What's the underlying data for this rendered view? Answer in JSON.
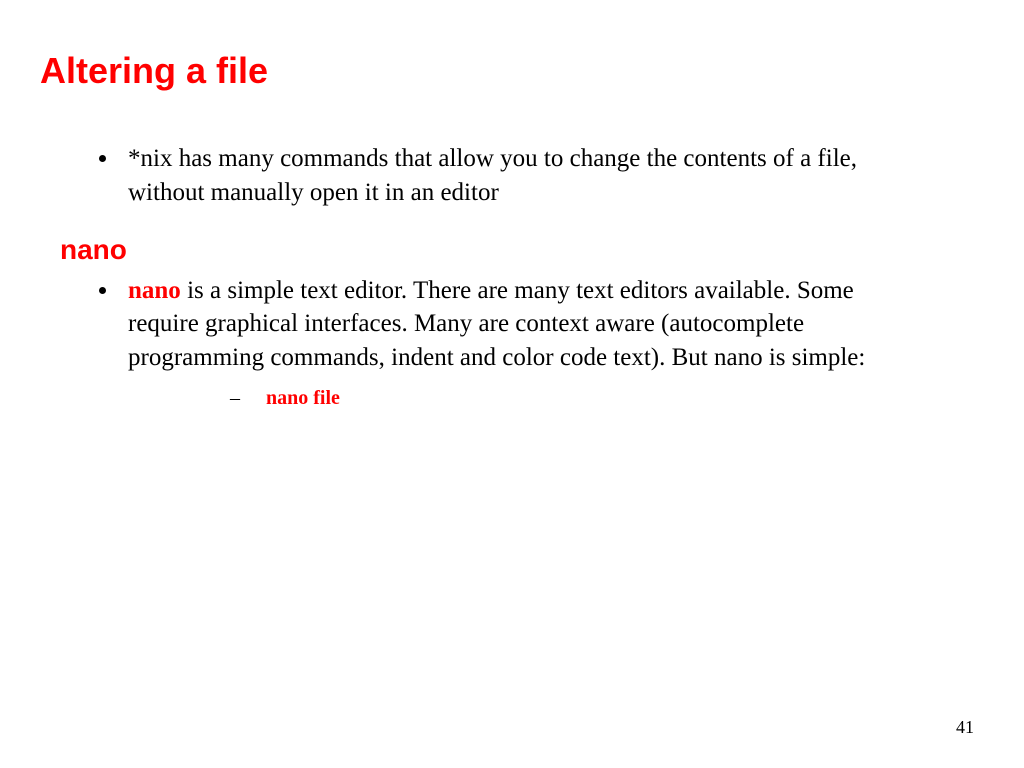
{
  "title": "Altering a file",
  "bullet1": "*nix has many commands that allow you to change the contents of a file, without manually open it in an editor",
  "subheading": "nano",
  "nano_word": "nano",
  "bullet2_rest": " is a simple text editor. There are many text editors available. Some require graphical interfaces. Many are context aware (autocomplete programming commands, indent and color code text). But nano is simple:",
  "sub_bullet": "nano file",
  "page_number": "41"
}
